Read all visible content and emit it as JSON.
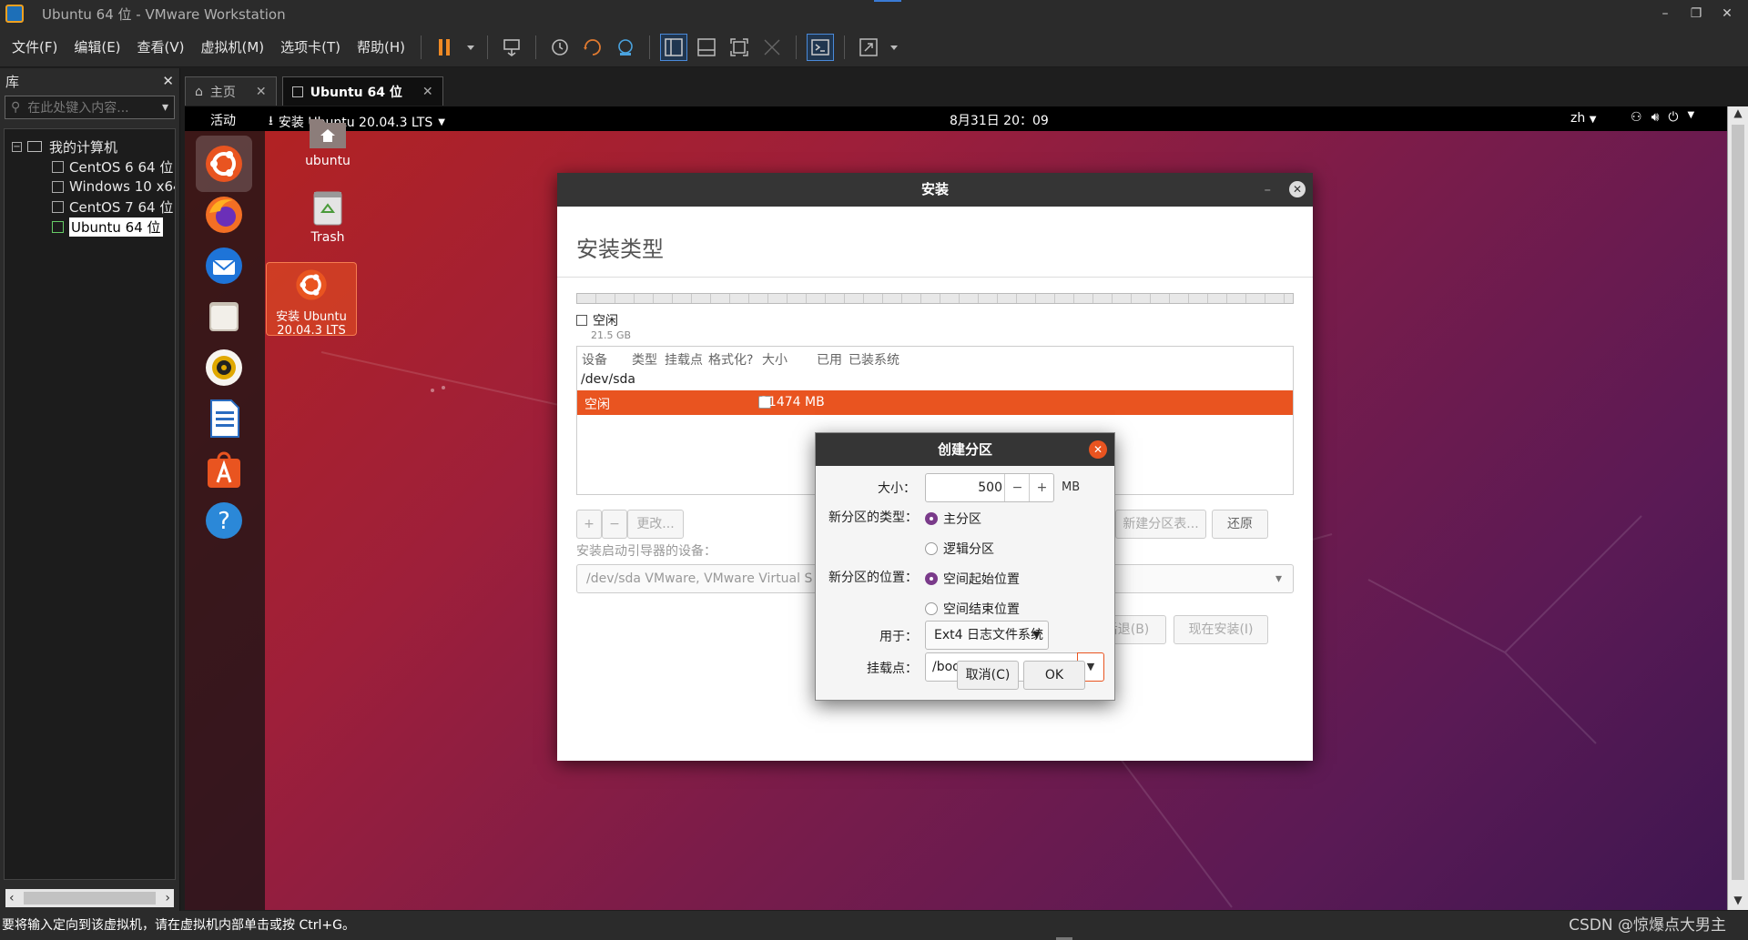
{
  "window": {
    "title": "Ubuntu 64 位 - VMware Workstation",
    "controls": [
      "–",
      "❐",
      "✕"
    ]
  },
  "menu": [
    "文件(F)",
    "编辑(E)",
    "查看(V)",
    "虚拟机(M)",
    "选项卡(T)",
    "帮助(H)"
  ],
  "library": {
    "title": "库",
    "close": "✕",
    "search_placeholder": "在此处键入内容...",
    "root": "我的计算机",
    "vms": [
      "CentOS 6 64 位",
      "Windows 10 x64",
      "CentOS 7 64 位",
      "Ubuntu 64 位"
    ],
    "selected_vm": "Ubuntu 64 位"
  },
  "tabs": [
    {
      "label": "主页",
      "active": false
    },
    {
      "label": "Ubuntu 64 位",
      "active": true
    }
  ],
  "ubuntu_topbar": {
    "activities": "活动",
    "app_menu": "安装 Ubuntu 20.04.3 LTS",
    "clock": "8月31日 20：09",
    "lang": "zh"
  },
  "desktop_icons": [
    {
      "label": "ubuntu"
    },
    {
      "label": "Trash"
    },
    {
      "label_line1": "安装 Ubuntu",
      "label_line2": "20.04.3 LTS"
    }
  ],
  "installer": {
    "title": "安装",
    "page_title": "安装类型",
    "legend_label": "空闲",
    "legend_size": "21.5 GB",
    "columns": [
      "设备",
      "类型",
      "挂载点",
      "格式化?",
      "大小",
      "已用",
      "已装系统"
    ],
    "device": "/dev/sda",
    "row": {
      "device": "空闲",
      "size": "21474 MB"
    },
    "buttons": {
      "add": "+",
      "remove": "−",
      "change": "更改...",
      "new_table": "新建分区表...",
      "revert": "还原"
    },
    "boot_label": "安装启动引导器的设备：",
    "boot_device": "/dev/sda VMware, VMware Virtual S (21.5 GB)",
    "back": "后退(B)",
    "install_now": "现在安装(I)"
  },
  "dialog": {
    "title": "创建分区",
    "size_label": "大小：",
    "size_value": "500",
    "size_unit": "MB",
    "type_label": "新分区的类型：",
    "type_options": [
      "主分区",
      "逻辑分区"
    ],
    "type_selected": "主分区",
    "location_label": "新分区的位置：",
    "location_options": [
      "空间起始位置",
      "空间结束位置"
    ],
    "location_selected": "空间起始位置",
    "use_label": "用于：",
    "use_value": "Ext4 日志文件系统",
    "mount_label": "挂载点：",
    "mount_value": "/boot",
    "cancel": "取消(C)",
    "ok": "OK"
  },
  "statusbar": {
    "message": "要将输入定向到该虚拟机，请在虚拟机内部单击或按 Ctrl+G。",
    "watermark": "CSDN @惊爆点大男主"
  },
  "colors": {
    "ubuntu_orange": "#E95420",
    "radio_selected": "#7A3B8A",
    "vmware_chrome": "#2B2B2B",
    "desktop_top": "#B5231F",
    "desktop_bottom": "#3E1650"
  }
}
